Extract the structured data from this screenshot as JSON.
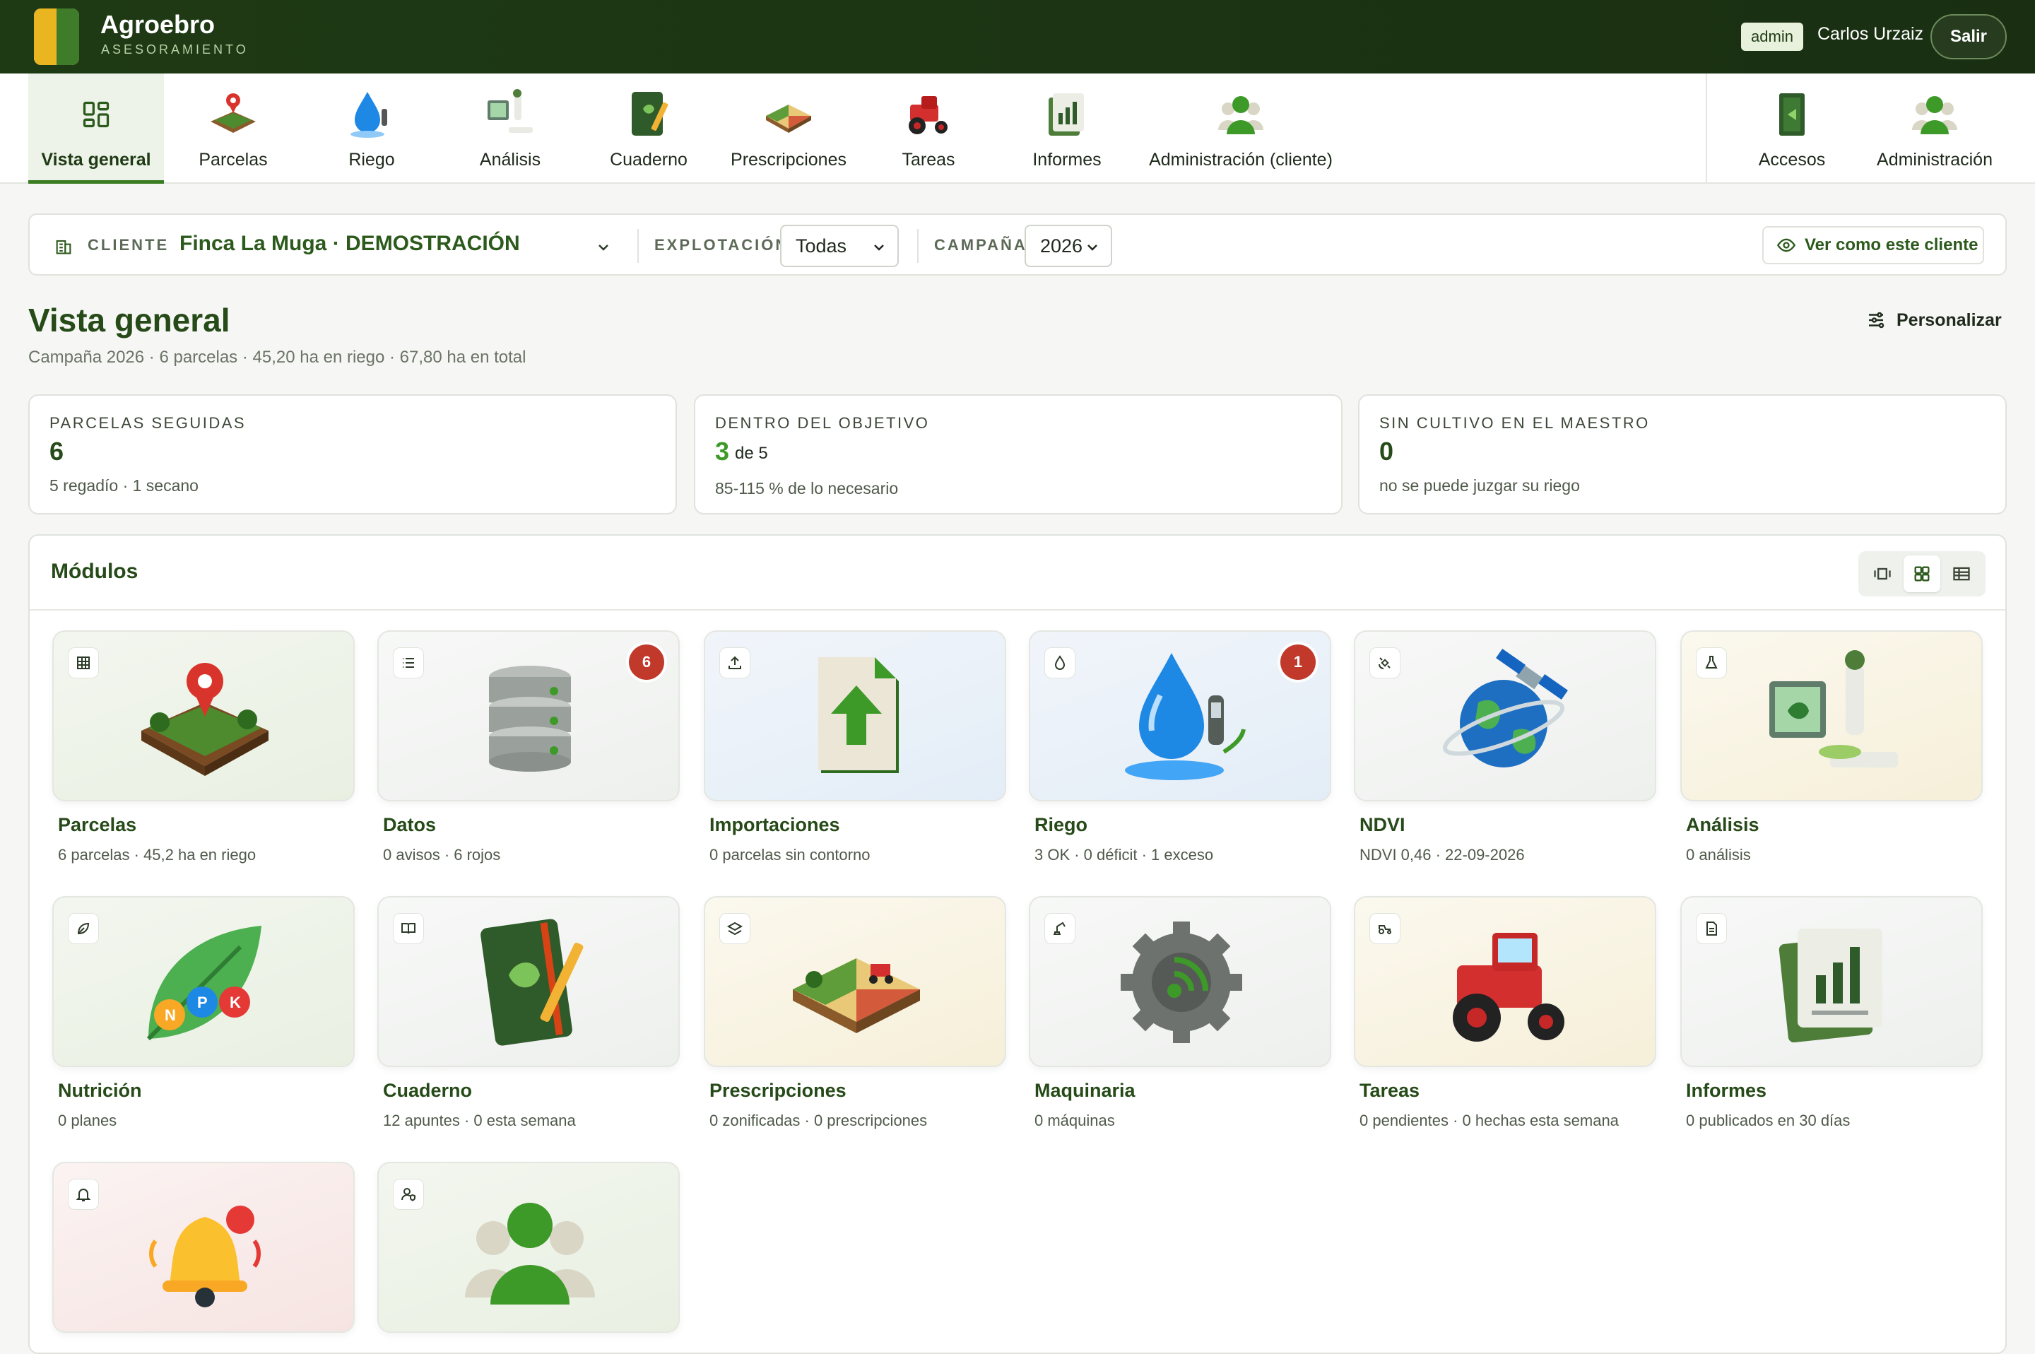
{
  "app": {
    "brand": "Agroebro",
    "brand_sub": "ASESORAMIENTO",
    "role_badge": "admin",
    "user_name": "Carlos Urzaiz",
    "logout_label": "Salir"
  },
  "nav": {
    "items": [
      {
        "label": "Vista general",
        "icon": "dashboard-grid-icon"
      },
      {
        "label": "Parcelas",
        "icon": "field-pin-icon"
      },
      {
        "label": "Riego",
        "icon": "water-drop-icon"
      },
      {
        "label": "Análisis",
        "icon": "microscope-icon"
      },
      {
        "label": "Cuaderno",
        "icon": "notebook-icon"
      },
      {
        "label": "Prescripciones",
        "icon": "prescription-map-icon"
      },
      {
        "label": "Tareas",
        "icon": "tractor-icon"
      },
      {
        "label": "Informes",
        "icon": "report-icon"
      },
      {
        "label": "Administración (cliente)",
        "icon": "users-icon"
      }
    ],
    "right_items": [
      {
        "label": "Accesos",
        "icon": "door-icon"
      },
      {
        "label": "Administración",
        "icon": "users-icon"
      }
    ]
  },
  "filters": {
    "client_label": "CLIENTE",
    "client_value": "Finca La Muga · DEMOSTRACIÓN",
    "farm_label": "EXPLOTACIÓN",
    "farm_value": "Todas",
    "season_label": "CAMPAÑA",
    "season_value": "2026",
    "view_as_label": "Ver como este cliente"
  },
  "page": {
    "title": "Vista general",
    "subtitle": "Campaña 2026 · 6 parcelas · 45,20 ha en riego · 67,80 ha en total",
    "customize_label": "Personalizar"
  },
  "stats": [
    {
      "label": "PARCELAS SEGUIDAS",
      "value": "6",
      "note": "5 regadío · 1 secano"
    },
    {
      "label": "DENTRO DEL OBJETIVO",
      "value": "3",
      "of": "de 5",
      "note": "85-115 % de lo necesario"
    },
    {
      "label": "SIN CULTIVO EN EL MAESTRO",
      "value": "0",
      "note": "no se puede juzgar su riego"
    }
  ],
  "modules": {
    "title": "Módulos",
    "items": [
      {
        "name": "Parcelas",
        "desc": "6 parcelas · 45,2 ha en riego",
        "icon": "table-icon",
        "badge": ""
      },
      {
        "name": "Datos",
        "desc": "0 avisos · 6 rojos",
        "icon": "list-icon",
        "badge": "6"
      },
      {
        "name": "Importaciones",
        "desc": "0 parcelas sin contorno",
        "icon": "upload-icon",
        "badge": ""
      },
      {
        "name": "Riego",
        "desc": "3 OK · 0 déficit · 1 exceso",
        "icon": "drop-icon",
        "badge": "1"
      },
      {
        "name": "NDVI",
        "desc": "NDVI 0,46 · 22-09-2026",
        "icon": "satellite-icon",
        "badge": ""
      },
      {
        "name": "Análisis",
        "desc": "0 análisis",
        "icon": "flask-icon",
        "badge": ""
      },
      {
        "name": "Nutrición",
        "desc": "0 planes",
        "icon": "leaf-icon",
        "badge": ""
      },
      {
        "name": "Cuaderno",
        "desc": "12 apuntes · 0 esta semana",
        "icon": "book-icon",
        "badge": ""
      },
      {
        "name": "Prescripciones",
        "desc": "0 zonificadas · 0 prescripciones",
        "icon": "map-icon",
        "badge": ""
      },
      {
        "name": "Maquinaria",
        "desc": "0 máquinas",
        "icon": "excavator-icon",
        "badge": ""
      },
      {
        "name": "Tareas",
        "desc": "0 pendientes · 0 hechas esta semana",
        "icon": "tractor-icon",
        "badge": ""
      },
      {
        "name": "Informes",
        "desc": "0 publicados en 30 días",
        "icon": "file-icon",
        "badge": ""
      },
      {
        "name": "",
        "desc": "",
        "icon": "bell-icon",
        "badge": ""
      },
      {
        "name": "",
        "desc": "",
        "icon": "user-shield-icon",
        "badge": ""
      }
    ]
  },
  "colors": {
    "brand_dark": "#1e3a14",
    "accent_green": "#3b7d23",
    "title_green": "#264a18",
    "badge_red": "#c0392b"
  }
}
